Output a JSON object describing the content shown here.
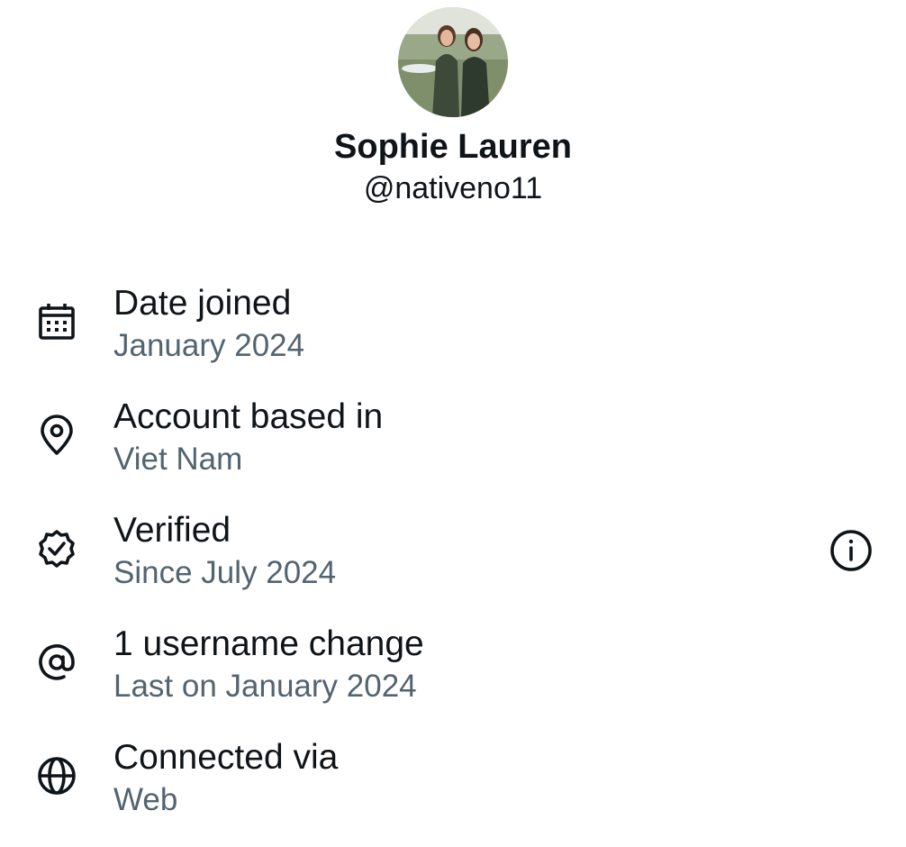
{
  "profile": {
    "display_name": "Sophie Lauren",
    "handle": "@nativeno11"
  },
  "about": {
    "items": [
      {
        "icon": "calendar-icon",
        "title": "Date joined",
        "subtitle": "January 2024"
      },
      {
        "icon": "location-pin-icon",
        "title": "Account based in",
        "subtitle": "Viet Nam"
      },
      {
        "icon": "verified-badge-icon",
        "title": "Verified",
        "subtitle": "Since July 2024",
        "action_icon": "info-icon"
      },
      {
        "icon": "at-sign-icon",
        "title": "1 username change",
        "subtitle": "Last on January 2024"
      },
      {
        "icon": "globe-icon",
        "title": "Connected via",
        "subtitle": "Web"
      }
    ]
  },
  "colors": {
    "primary_text": "#0f1419",
    "secondary_text": "#536471",
    "background": "#ffffff"
  }
}
